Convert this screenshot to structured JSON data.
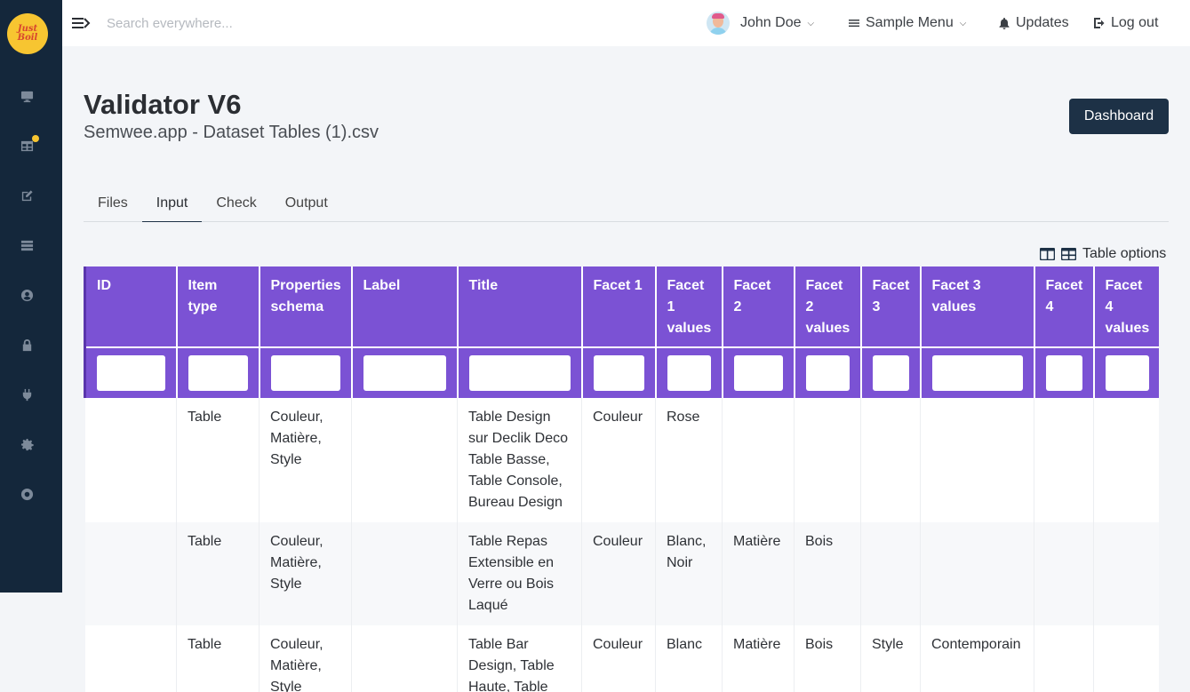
{
  "brand": {
    "logo_text_line1": "Just",
    "logo_text_line2": "Boil"
  },
  "topbar": {
    "search_placeholder": "Search everywhere...",
    "user_name": "John Doe",
    "sample_menu": "Sample Menu",
    "updates": "Updates",
    "logout": "Log out"
  },
  "header": {
    "title": "Validator V6",
    "subtitle": "Semwee.app - Dataset Tables (1).csv",
    "dashboard_button": "Dashboard"
  },
  "tabs": [
    {
      "label": "Files"
    },
    {
      "label": "Input"
    },
    {
      "label": "Check"
    },
    {
      "label": "Output"
    }
  ],
  "active_tab": "Input",
  "table_options_label": "Table options",
  "table": {
    "columns": [
      "ID",
      "Item type",
      "Properties schema",
      "Label",
      "Title",
      "Facet 1",
      "Facet 1 values",
      "Facet 2",
      "Facet 2 values",
      "Facet 3",
      "Facet 3 values",
      "Facet 4",
      "Facet 4 values"
    ],
    "rows": [
      [
        "",
        "Table",
        "Couleur, Matière, Style",
        "",
        "Table Design sur Declik Deco Table Basse, Table Console, Bureau Design",
        "Couleur",
        "Rose",
        "",
        "",
        "",
        "",
        "",
        ""
      ],
      [
        "",
        "Table",
        "Couleur, Matière, Style",
        "",
        "Table Repas Extensible en Verre ou Bois Laqué",
        "Couleur",
        "Blanc, Noir",
        "Matière",
        "Bois",
        "",
        "",
        "",
        ""
      ],
      [
        "",
        "Table",
        "Couleur, Matière, Style",
        "",
        "Table Bar Design, Table Haute, Table",
        "Couleur",
        "Blanc",
        "Matière",
        "Bois",
        "Style",
        "Contemporain",
        "",
        ""
      ]
    ]
  },
  "colors": {
    "sidebar": "#14273b",
    "header_purple": "#7b52d4",
    "dashboard_button": "#1d3146",
    "logo_yellow": "#f7c531",
    "notification_dot": "#f7c531"
  },
  "icons": {
    "sidebar": [
      "monitor-icon",
      "grid-icon",
      "edit-icon",
      "list-icon",
      "user-circle-icon",
      "lock-icon",
      "plug-icon",
      "gear-icon",
      "lifebuoy-icon"
    ],
    "topbar": [
      "hamburger-icon",
      "chevron-down-icon",
      "menu-lines-icon",
      "bell-icon",
      "logout-icon"
    ],
    "table_options": [
      "columns-icon",
      "grid-icon"
    ]
  }
}
